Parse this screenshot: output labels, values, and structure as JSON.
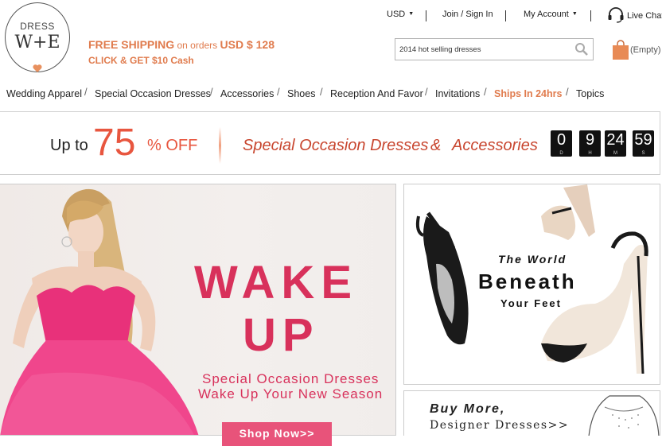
{
  "brand": {
    "logo_line1": "DRESS",
    "logo_line2": "W+E"
  },
  "shipping": {
    "line1_a": "FREE SHIPPING",
    "line1_b": " on orders ",
    "line1_c": "USD $  128",
    "line2": "CLICK & GET $10 Cash"
  },
  "topbar": {
    "currency": "USD",
    "join": "Join / Sign In",
    "account": "My Account",
    "live_chat": "Live Chat"
  },
  "search": {
    "value": "2014 hot selling dresses"
  },
  "cart": {
    "status": "(Empty)"
  },
  "nav": {
    "items": [
      "Wedding Apparel",
      "Special Occasion Dresses",
      "Accessories",
      "Shoes",
      "Reception And Favor",
      "Invitations",
      "Ships In 24hrs",
      "Topics"
    ],
    "separator": "/"
  },
  "promo": {
    "up_to": "Up to",
    "percent": "75",
    "off": "% OFF",
    "text1": "Special Occasion Dresses",
    "amp": "&",
    "text2": "Accessories",
    "countdown": [
      {
        "value": "0",
        "unit": "D"
      },
      {
        "value": "9",
        "unit": "H"
      },
      {
        "value": "24",
        "unit": "M"
      },
      {
        "value": "59",
        "unit": "S"
      }
    ]
  },
  "banner_main": {
    "line1": "WAKE",
    "line2": "UP",
    "sub1": "Special Occasion Dresses",
    "sub2": "Wake Up Your New Season",
    "cta": "Shop Now>>"
  },
  "banner_shoes": {
    "line1": "The World",
    "line2": "Beneath",
    "line3": "Your Feet"
  },
  "banner_more": {
    "line1": "Buy More,",
    "line2": "Designer Dresses>>"
  },
  "colors": {
    "accent_orange": "#e07b4d",
    "promo_red": "#e8563f",
    "pink": "#d8315b"
  }
}
